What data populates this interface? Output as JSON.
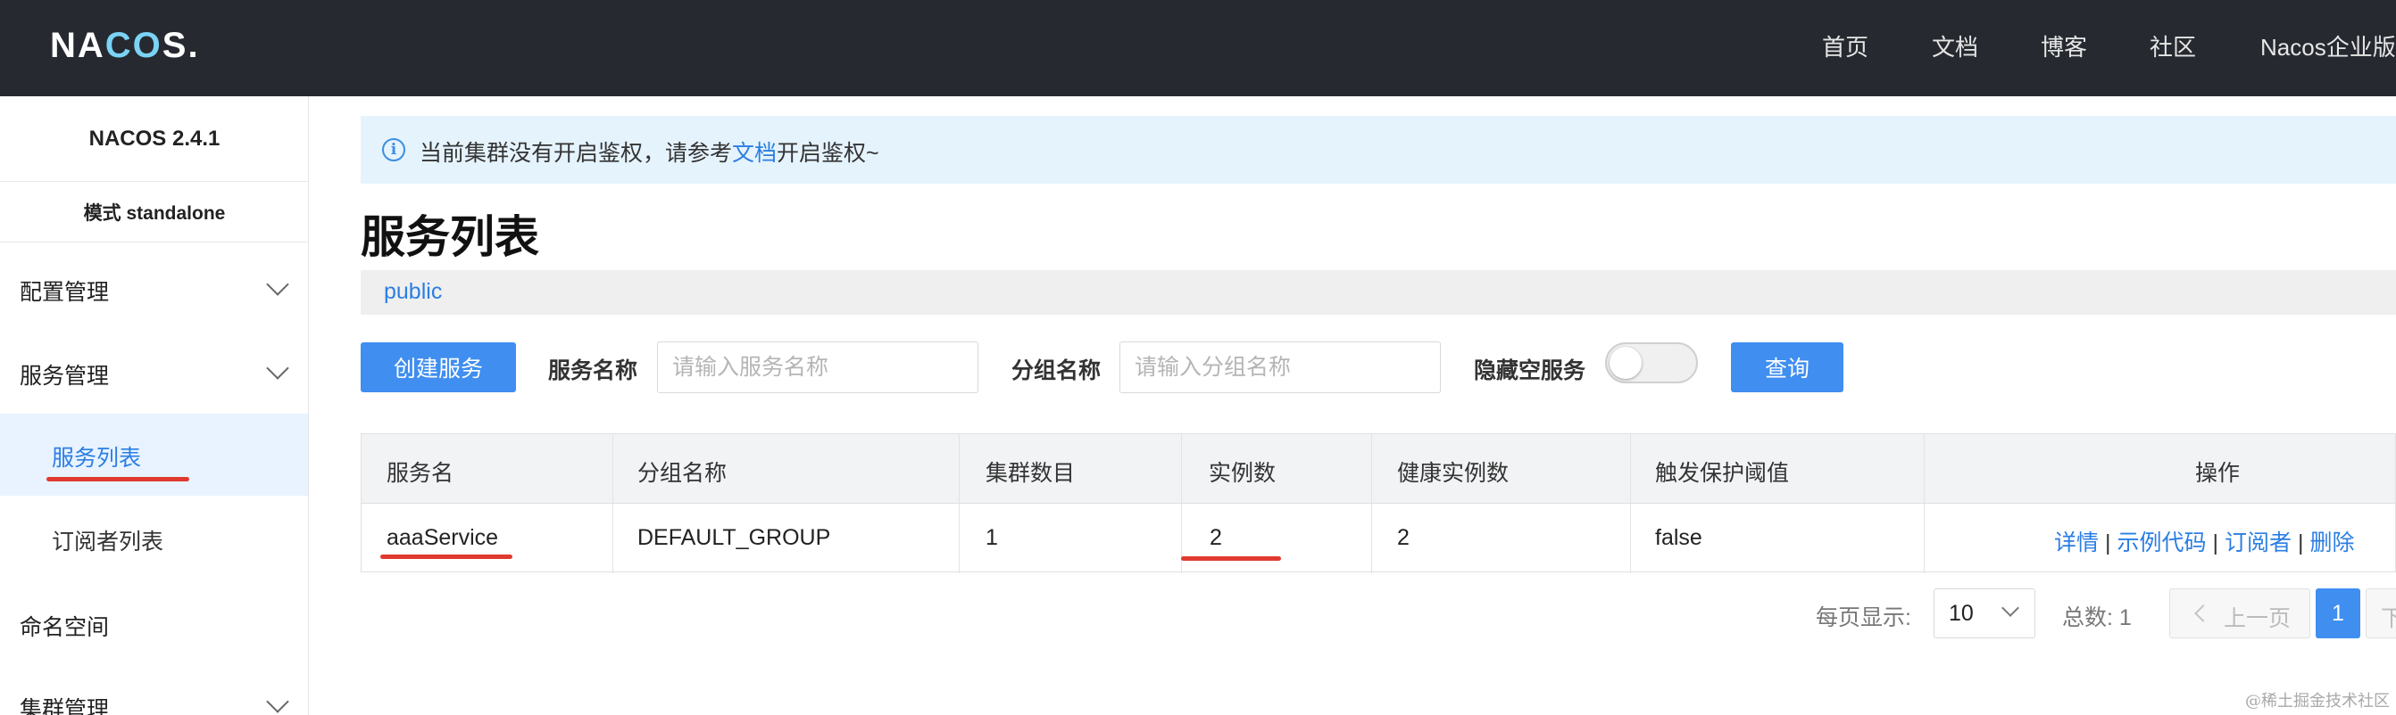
{
  "header": {
    "logo_text": "NACOS.",
    "nav": [
      "首页",
      "文档",
      "博客",
      "社区",
      "Nacos企业版"
    ]
  },
  "sidebar": {
    "version": "NACOS 2.4.1",
    "mode": "模式 standalone",
    "groups": [
      {
        "label": "配置管理"
      },
      {
        "label": "服务管理"
      },
      {
        "label": "命名空间"
      },
      {
        "label": "集群管理"
      }
    ],
    "sub_items": [
      "服务列表",
      "订阅者列表"
    ]
  },
  "notice": {
    "icon": "info-icon",
    "icon_glyph": "i",
    "text_before": "当前集群没有开启鉴权，请参考",
    "link": "文档",
    "text_after": "开启鉴权~"
  },
  "page": {
    "title": "服务列表",
    "namespace": "public"
  },
  "toolbar": {
    "create_label": "创建服务",
    "service_name_label": "服务名称",
    "service_name_placeholder": "请输入服务名称",
    "group_name_label": "分组名称",
    "group_name_placeholder": "请输入分组名称",
    "hide_empty_label": "隐藏空服务",
    "query_label": "查询"
  },
  "table": {
    "columns": [
      "服务名",
      "分组名称",
      "集群数目",
      "实例数",
      "健康实例数",
      "触发保护阈值",
      "操作"
    ],
    "rows": [
      {
        "service_name": "aaaService",
        "group_name": "DEFAULT_GROUP",
        "cluster_count": "1",
        "instance_count": "2",
        "healthy_count": "2",
        "protect_threshold": "false",
        "actions": [
          "详情",
          "示例代码",
          "订阅者",
          "删除"
        ]
      }
    ]
  },
  "pagination": {
    "per_page_label": "每页显示:",
    "per_page_value": "10",
    "total_label": "总数: 1",
    "prev_label": "上一页",
    "current_page": "1",
    "next_label": "下"
  },
  "watermark": "@稀土掘金技术社区",
  "colors": {
    "header_bg": "#262a30",
    "primary": "#3f8ef0",
    "link": "#2b7ee3",
    "annotation": "#e03a2f"
  }
}
